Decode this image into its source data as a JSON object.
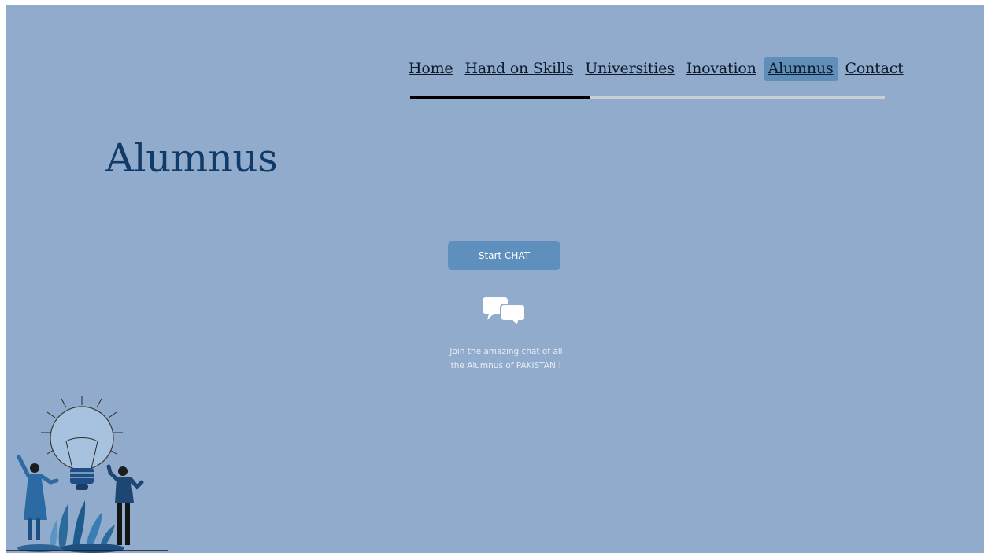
{
  "nav": {
    "items": [
      {
        "label": "Home",
        "active": false
      },
      {
        "label": "Hand on Skills",
        "active": false
      },
      {
        "label": "Universities",
        "active": false
      },
      {
        "label": "Inovation",
        "active": false
      },
      {
        "label": "Alumnus",
        "active": true
      },
      {
        "label": "Contact",
        "active": false
      }
    ],
    "progress_fraction": 0.38
  },
  "page_title": "Alumnus",
  "chat": {
    "button_label": "Start CHAT",
    "description_line1": "Join the amazing chat of all",
    "description_line2": "the Alumnus of PAKISTAN !"
  },
  "icons": {
    "chat": "chat-bubbles-icon",
    "illustration": "lightbulb-people-illustration"
  },
  "colors": {
    "background": "#90abcc",
    "accent": "#5e8fbd",
    "title": "#103a68",
    "progress_fill": "#000000",
    "progress_track": "#c8ced6"
  }
}
